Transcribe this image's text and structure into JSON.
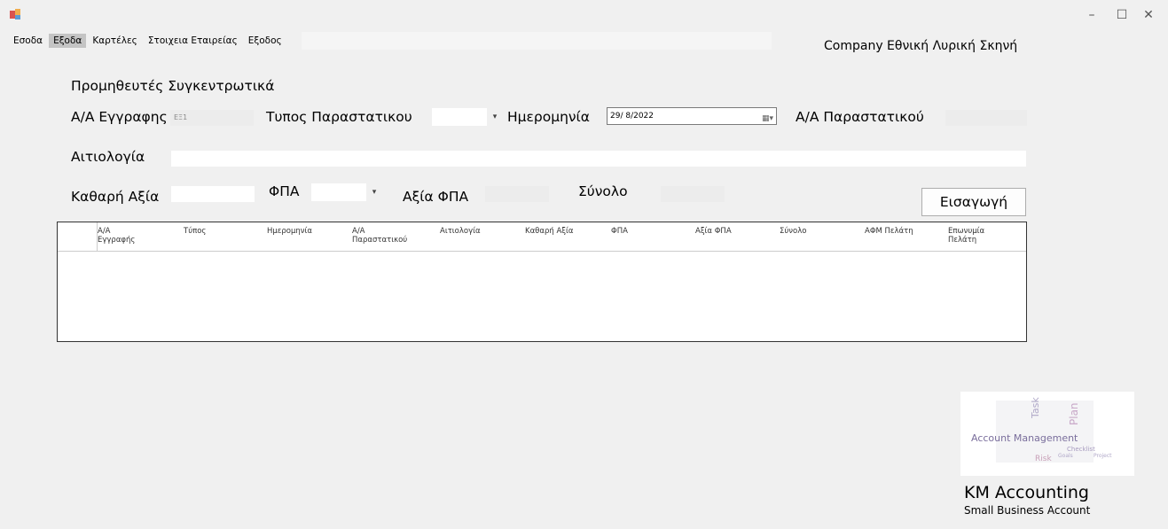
{
  "window": {
    "minimize": "–",
    "maximize": "☐",
    "close": "✕"
  },
  "menu": [
    "Εσοδα",
    "Εξοδα",
    "Καρτέλες",
    "Στοιχεια Εταιρείας",
    "Εξοδος"
  ],
  "company": "Company Εθνική Λυρική Σκηνή",
  "form": {
    "title": "Προμηθευτές Συγκεντρωτικά",
    "aa_egrafis_label": "Α/Α Εγγραφης",
    "aa_egrafis_value": "ΕΞ1",
    "typos_label": "Τυπος Παραστατικου",
    "imerominia_label": "Ημερομηνία",
    "imerominia_value": "29/ 8/2022",
    "aa_parastatikou_label": "Α/Α Παραστατικού",
    "aitiologia_label": "Αιτιολογία",
    "kathari_label": "Καθαρή Αξία",
    "fpa_label": "ΦΠΑ",
    "axia_fpa_label": "Αξία ΦΠΑ",
    "synolo_label": "Σύνολο",
    "insert_button": "Εισαγωγή"
  },
  "grid": {
    "columns": [
      "Α/Α Εγγραφής",
      "Τύπος",
      "Ημερομηνία",
      "Α/Α Παραστατικού",
      "Αιτιολογία",
      "Καθαρή Αξία",
      "ΦΠΑ",
      "Αξία ΦΠΑ",
      "Σύνολο",
      "ΑΦΜ Πελάτη",
      "Επωνυμία Πελάτη"
    ]
  },
  "logo": {
    "words": [
      "Task",
      "Plan",
      "Account Management",
      "Checklist",
      "Risk",
      "Goals",
      "Project"
    ]
  },
  "brand": {
    "name": "KM Accounting",
    "tagline": "Small Business Account"
  }
}
